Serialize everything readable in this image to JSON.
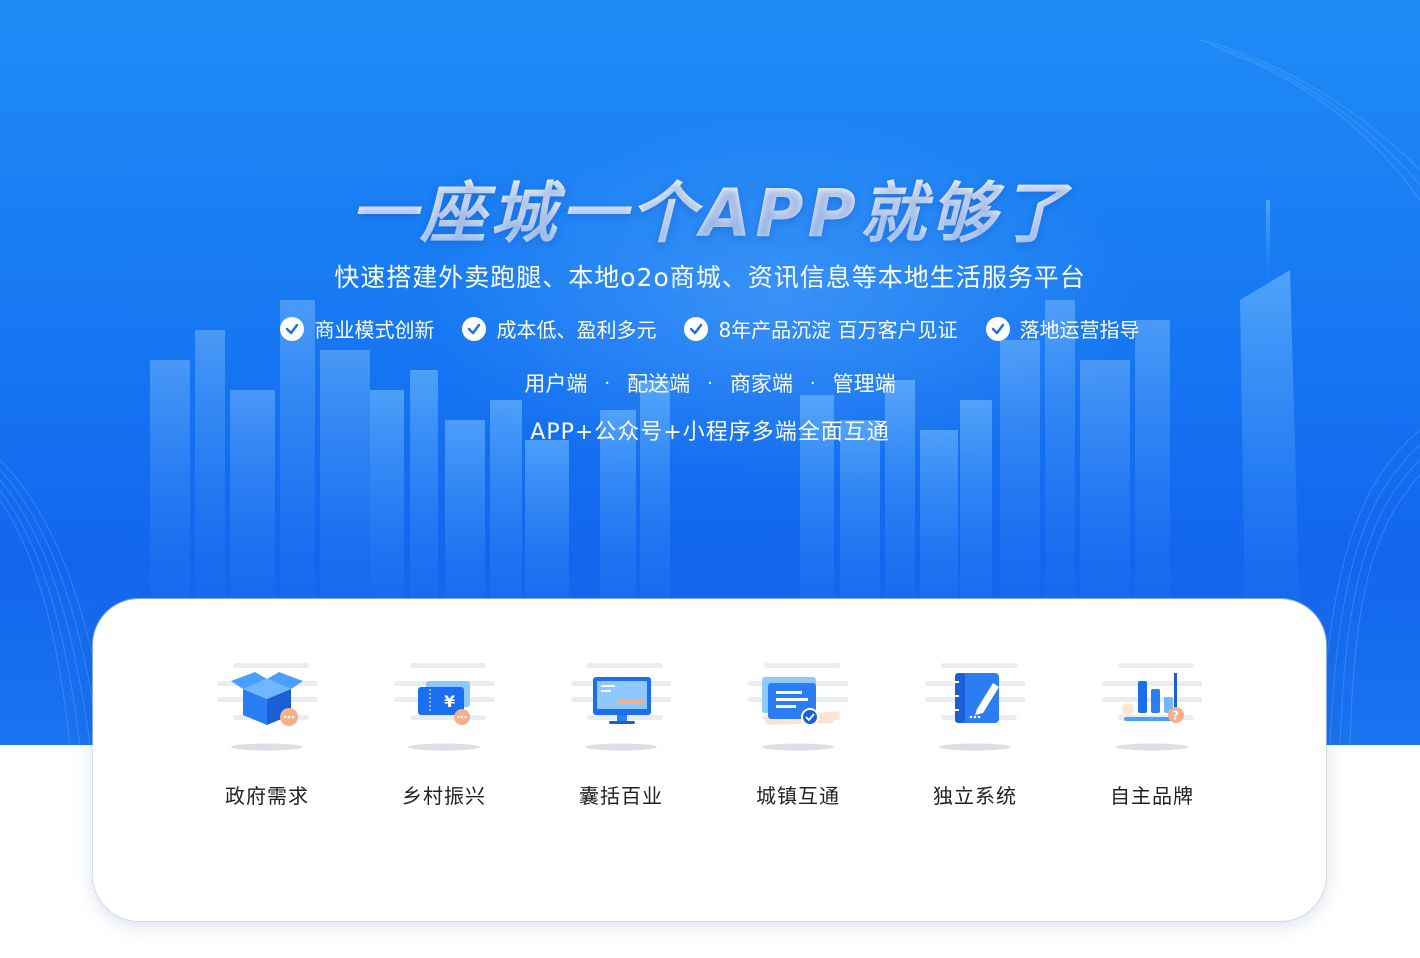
{
  "hero": {
    "title": "一座城一个APP就够了",
    "subtitle": "快速搭建外卖跑腿、本地o2o商城、资讯信息等本地生活服务平台",
    "features": [
      {
        "icon": "check-circle-icon",
        "label": "商业模式创新"
      },
      {
        "icon": "check-circle-icon",
        "label": "成本低、盈利多元"
      },
      {
        "icon": "check-circle-icon",
        "label": "8年产品沉淀 百万客户见证"
      },
      {
        "icon": "check-circle-icon",
        "label": "落地运营指导"
      }
    ],
    "endpoints": [
      "用户端",
      "配送端",
      "商家端",
      "管理端"
    ],
    "separator": "·",
    "multi_platform": "APP+公众号+小程序多端全面互通"
  },
  "solutions": [
    {
      "icon": "box-icon",
      "label": "政府需求"
    },
    {
      "icon": "ticket-icon",
      "label": "乡村振兴"
    },
    {
      "icon": "monitor-icon",
      "label": "囊括百业"
    },
    {
      "icon": "document-icon",
      "label": "城镇互通"
    },
    {
      "icon": "notebook-pen-icon",
      "label": "独立系统"
    },
    {
      "icon": "bar-chart-icon",
      "label": "自主品牌"
    }
  ],
  "colors": {
    "hero_top": "#1f8cf6",
    "hero_bottom": "#1266ee",
    "icon_blue": "#1a6ff0",
    "icon_light": "#6fb8ff",
    "accent_orange": "#f5b08a"
  }
}
